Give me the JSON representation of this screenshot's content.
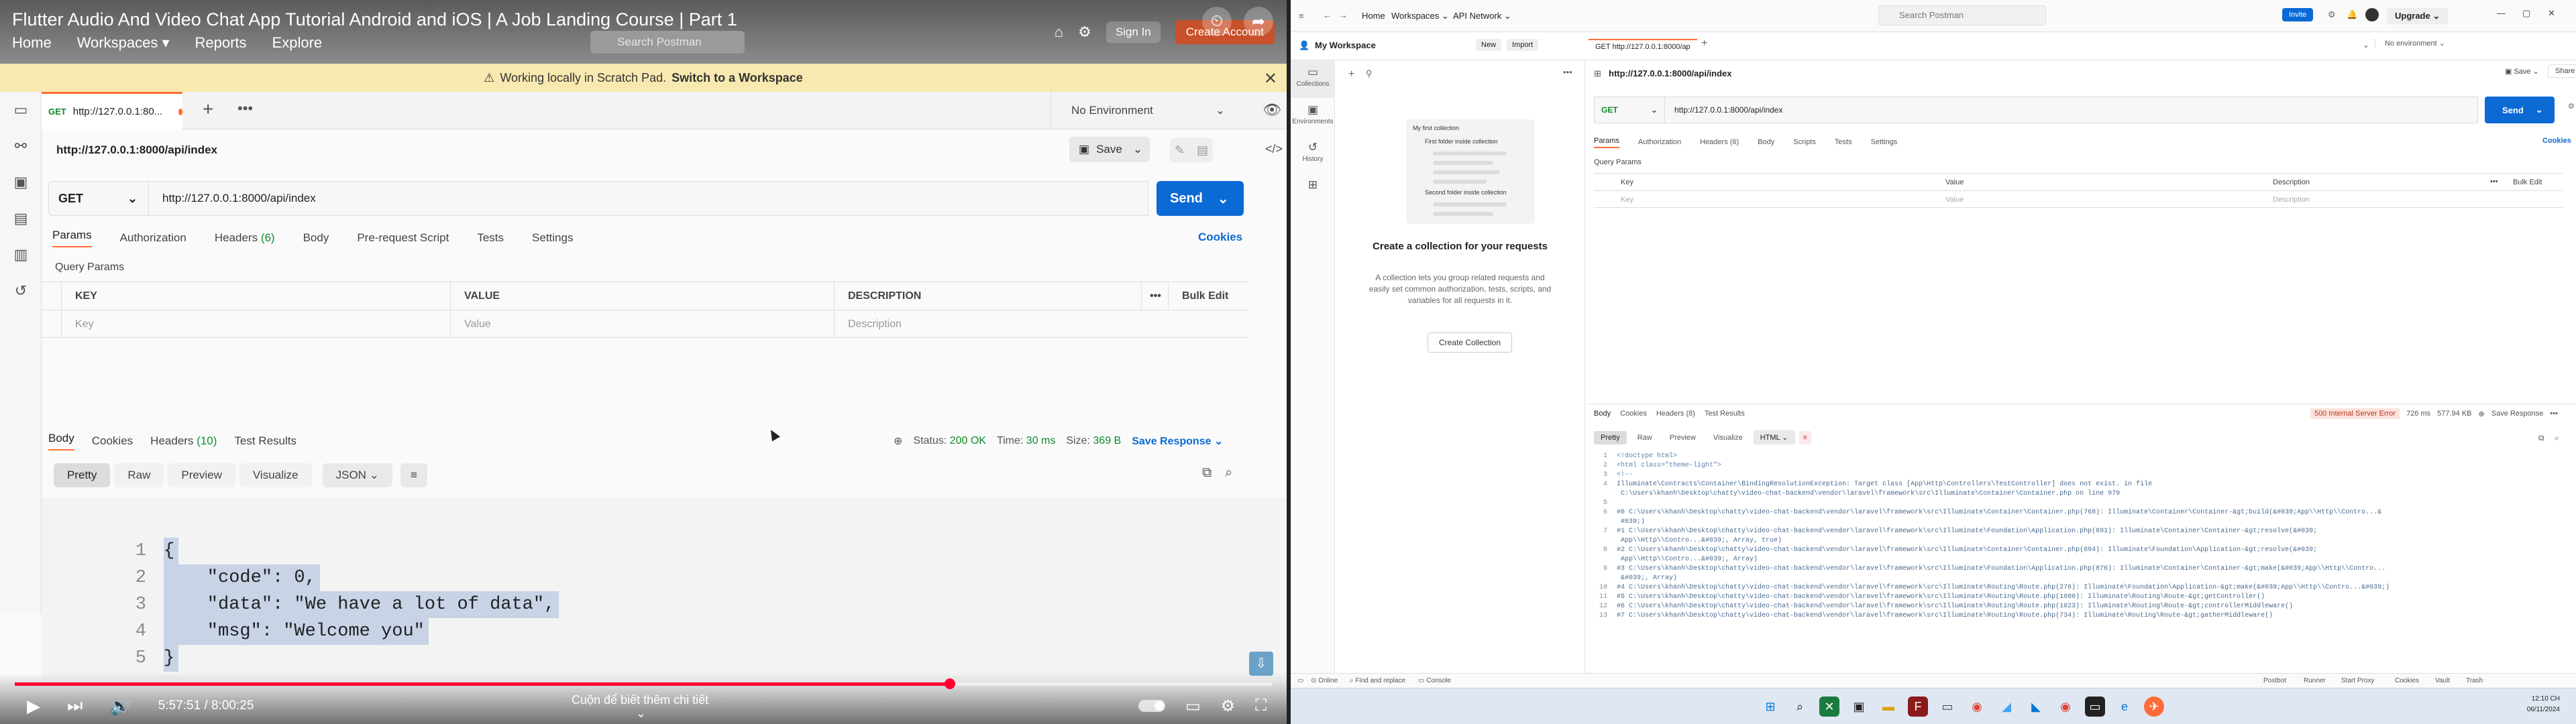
{
  "video": {
    "title": "Flutter Audio And Video Chat App Tutorial Android and iOS | A Job Landing Course | Part 1",
    "nav": [
      "Home",
      "Workspaces",
      "Reports",
      "Explore"
    ],
    "search_placeholder": "Search Postman",
    "sign_in": "Sign In",
    "create_account": "Create Account",
    "banner_text": "Working locally in Scratch Pad.",
    "banner_link": "Switch to a Workspace",
    "tab_method": "GET",
    "tab_label": "http://127.0.0.1:80...",
    "environment": "No Environment",
    "request_title": "http://127.0.0.1:8000/api/index",
    "save": "Save",
    "method": "GET",
    "url": "http://127.0.0.1:8000/api/index",
    "send": "Send",
    "req_tabs": [
      "Params",
      "Authorization",
      "Headers",
      "Body",
      "Pre-request Script",
      "Tests",
      "Settings"
    ],
    "headers_count": "(6)",
    "cookies": "Cookies",
    "query_params": "Query Params",
    "cols": [
      "KEY",
      "VALUE",
      "DESCRIPTION"
    ],
    "bulk_edit": "Bulk Edit",
    "placeholders": [
      "Key",
      "Value",
      "Description"
    ],
    "resp_tabs": [
      "Body",
      "Cookies",
      "Headers",
      "Test Results"
    ],
    "resp_headers_count": "(10)",
    "status_label": "Status:",
    "status": "200 OK",
    "time_label": "Time:",
    "time": "30 ms",
    "size_label": "Size:",
    "size": "369 B",
    "save_response": "Save Response",
    "view_modes": [
      "Pretty",
      "Raw",
      "Preview",
      "Visualize"
    ],
    "format": "JSON",
    "code": [
      {
        "n": "1",
        "t": "{"
      },
      {
        "n": "2",
        "t": "    \"code\": 0,"
      },
      {
        "n": "3",
        "t": "    \"data\": \"We have a lot of data\","
      },
      {
        "n": "4",
        "t": "    \"msg\": \"Welcome you\""
      },
      {
        "n": "5",
        "t": "}"
      }
    ],
    "time_display": "5:57:51 / 8:00:25",
    "hint": "Cuộn để biết thêm chi tiết",
    "progress": 0.744
  },
  "desktop": {
    "home": "Home",
    "workspaces": "Workspaces",
    "api_network": "API Network",
    "search": "Search Postman",
    "invite": "Invite",
    "upgrade": "Upgrade",
    "workspace": "My Workspace",
    "new": "New",
    "import": "Import",
    "tab": "GET http://127.0.0.1:8000/ap",
    "no_env": "No environment",
    "sidebar": [
      "Collections",
      "Environments",
      "History",
      ""
    ],
    "ill_rows": [
      "My first collection",
      "First folder inside collection",
      "Second folder inside collection"
    ],
    "create_title": "Create a collection for your requests",
    "create_desc": "A collection lets you group related requests and easily set common authorization, tests, scripts, and variables for all requests in it.",
    "create_btn": "Create Collection",
    "req_title": "http://127.0.0.1:8000/api/index",
    "save": "Save",
    "share": "Share",
    "method": "GET",
    "url": "http://127.0.0.1:8000/api/index",
    "send": "Send",
    "cookies": "Cookies",
    "req_tabs": [
      "Params",
      "Authorization",
      "Headers (6)",
      "Body",
      "Scripts",
      "Tests",
      "Settings"
    ],
    "query_params": "Query Params",
    "cols": [
      "Key",
      "Value",
      "Description"
    ],
    "bulk_edit": "Bulk Edit",
    "placeholders": [
      "Key",
      "Value",
      "Description"
    ],
    "resp_tabs": [
      "Body",
      "Cookies",
      "Headers (8)",
      "Test Results"
    ],
    "status": "500 Internal Server Error",
    "time": "726 ms",
    "size": "577.94 KB",
    "save_response": "Save Response",
    "view_modes": [
      "Pretty",
      "Raw",
      "Preview",
      "Visualize"
    ],
    "format": "HTML",
    "resp_lines": [
      {
        "n": "1",
        "t": "<!doctype html>"
      },
      {
        "n": "2",
        "t": "<html class=\"theme-light\">"
      },
      {
        "n": "3",
        "t": "<!--"
      },
      {
        "n": "4",
        "t": "Illuminate\\Contracts\\Container\\BindingResolutionException: Target class [App\\Http\\Controllers\\TestController] does not exist. in file"
      },
      {
        "n": "",
        "t": "    C:\\Users\\khanh\\Desktop\\chatty\\video-chat-backend\\vendor\\laravel\\framework\\src\\Illuminate\\Container\\Container.php on line 979"
      },
      {
        "n": "5",
        "t": ""
      },
      {
        "n": "6",
        "t": "#0 C:\\Users\\khanh\\Desktop\\chatty\\video-chat-backend\\vendor\\laravel\\framework\\src\\Illuminate\\Container\\Container.php(768): Illuminate\\Container\\Container-&gt;build(&#039;App\\\\Http\\\\Contro...&"
      },
      {
        "n": "",
        "t": "    #039;)"
      },
      {
        "n": "7",
        "t": "#1 C:\\Users\\khanh\\Desktop\\chatty\\video-chat-backend\\vendor\\laravel\\framework\\src\\Illuminate\\Foundation\\Application.php(891): Illuminate\\Container\\Container-&gt;resolve(&#039;"
      },
      {
        "n": "",
        "t": "    App\\\\Http\\\\Contro...&#039;, Array, true)"
      },
      {
        "n": "8",
        "t": "#2 C:\\Users\\khanh\\Desktop\\chatty\\video-chat-backend\\vendor\\laravel\\framework\\src\\Illuminate\\Container\\Container.php(694): Illuminate\\Foundation\\Application-&gt;resolve(&#039;"
      },
      {
        "n": "",
        "t": "    App\\\\Http\\\\Contro...&#039;, Array)"
      },
      {
        "n": "9",
        "t": "#3 C:\\Users\\khanh\\Desktop\\chatty\\video-chat-backend\\vendor\\laravel\\framework\\src\\Illuminate\\Foundation\\Application.php(876): Illuminate\\Container\\Container-&gt;make(&#039;App\\\\Http\\\\Contro..."
      },
      {
        "n": "",
        "t": "    &#039;, Array)"
      },
      {
        "n": "10",
        "t": "#4 C:\\Users\\khanh\\Desktop\\chatty\\video-chat-backend\\vendor\\laravel\\framework\\src\\Illuminate\\Routing\\Route.php(276): Illuminate\\Foundation\\Application-&gt;make(&#039;App\\\\Http\\\\Contro...&#039;)"
      },
      {
        "n": "11",
        "t": "#5 C:\\Users\\khanh\\Desktop\\chatty\\video-chat-backend\\vendor\\laravel\\framework\\src\\Illuminate\\Routing\\Route.php(1080): Illuminate\\Routing\\Route-&gt;getController()"
      },
      {
        "n": "12",
        "t": "#6 C:\\Users\\khanh\\Desktop\\chatty\\video-chat-backend\\vendor\\laravel\\framework\\src\\Illuminate\\Routing\\Route.php(1023): Illuminate\\Routing\\Route-&gt;controllerMiddleware()"
      },
      {
        "n": "13",
        "t": "#7 C:\\Users\\khanh\\Desktop\\chatty\\video-chat-backend\\vendor\\laravel\\framework\\src\\Illuminate\\Routing\\Route.php(734): Illuminate\\Routing\\Route-&gt;gatherMiddleware()"
      }
    ],
    "status_bar": [
      "Online",
      "Find and replace",
      "Console"
    ],
    "status_bar_right": [
      "Postbot",
      "Runner",
      "Start Proxy",
      "Cookies",
      "Vault",
      "Trash"
    ],
    "clock_time": "12:10 CH",
    "clock_date": "06/11/2024"
  }
}
